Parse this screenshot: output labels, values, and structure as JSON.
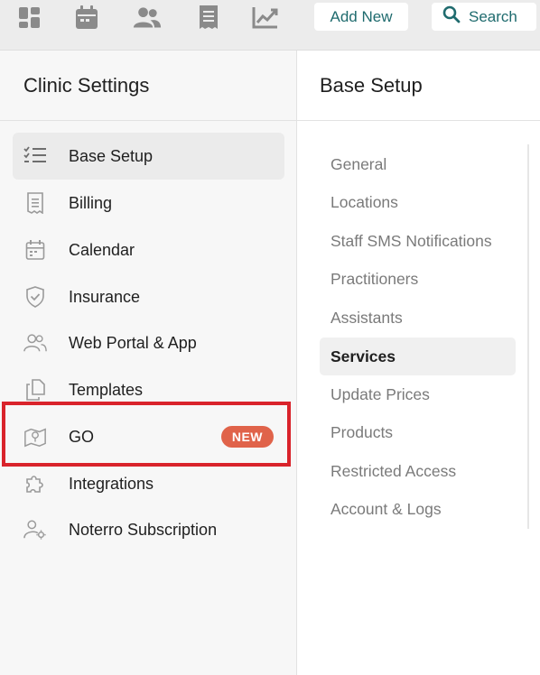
{
  "toolbar": {
    "icons": [
      "dashboard-icon",
      "calendar-icon",
      "people-icon",
      "receipt-icon",
      "chart-icon"
    ],
    "add_new_label": "Add New",
    "search_label": "Search",
    "accent_color": "#1f6b6e"
  },
  "left_panel": {
    "title": "Clinic Settings",
    "items": [
      {
        "label": "Base Setup",
        "icon": "checklist-icon",
        "active": true
      },
      {
        "label": "Billing",
        "icon": "receipt-icon"
      },
      {
        "label": "Calendar",
        "icon": "calendar-icon"
      },
      {
        "label": "Insurance",
        "icon": "shield-check-icon"
      },
      {
        "label": "Web Portal & App",
        "icon": "users-icon"
      },
      {
        "label": "Templates",
        "icon": "copy-icon"
      },
      {
        "label": "GO",
        "icon": "map-pin-icon",
        "badge": "NEW",
        "highlighted": true
      },
      {
        "label": "Integrations",
        "icon": "puzzle-icon"
      },
      {
        "label": "Noterro Subscription",
        "icon": "user-settings-icon"
      }
    ],
    "badge_color": "#e0634a",
    "highlight_color": "#d9232b"
  },
  "right_panel": {
    "title": "Base Setup",
    "items": [
      {
        "label": "General"
      },
      {
        "label": "Locations"
      },
      {
        "label": "Staff SMS Notifications"
      },
      {
        "label": "Practitioners"
      },
      {
        "label": "Assistants"
      },
      {
        "label": "Services",
        "active": true
      },
      {
        "label": "Update Prices"
      },
      {
        "label": "Products"
      },
      {
        "label": "Restricted Access"
      },
      {
        "label": "Account & Logs"
      }
    ]
  }
}
